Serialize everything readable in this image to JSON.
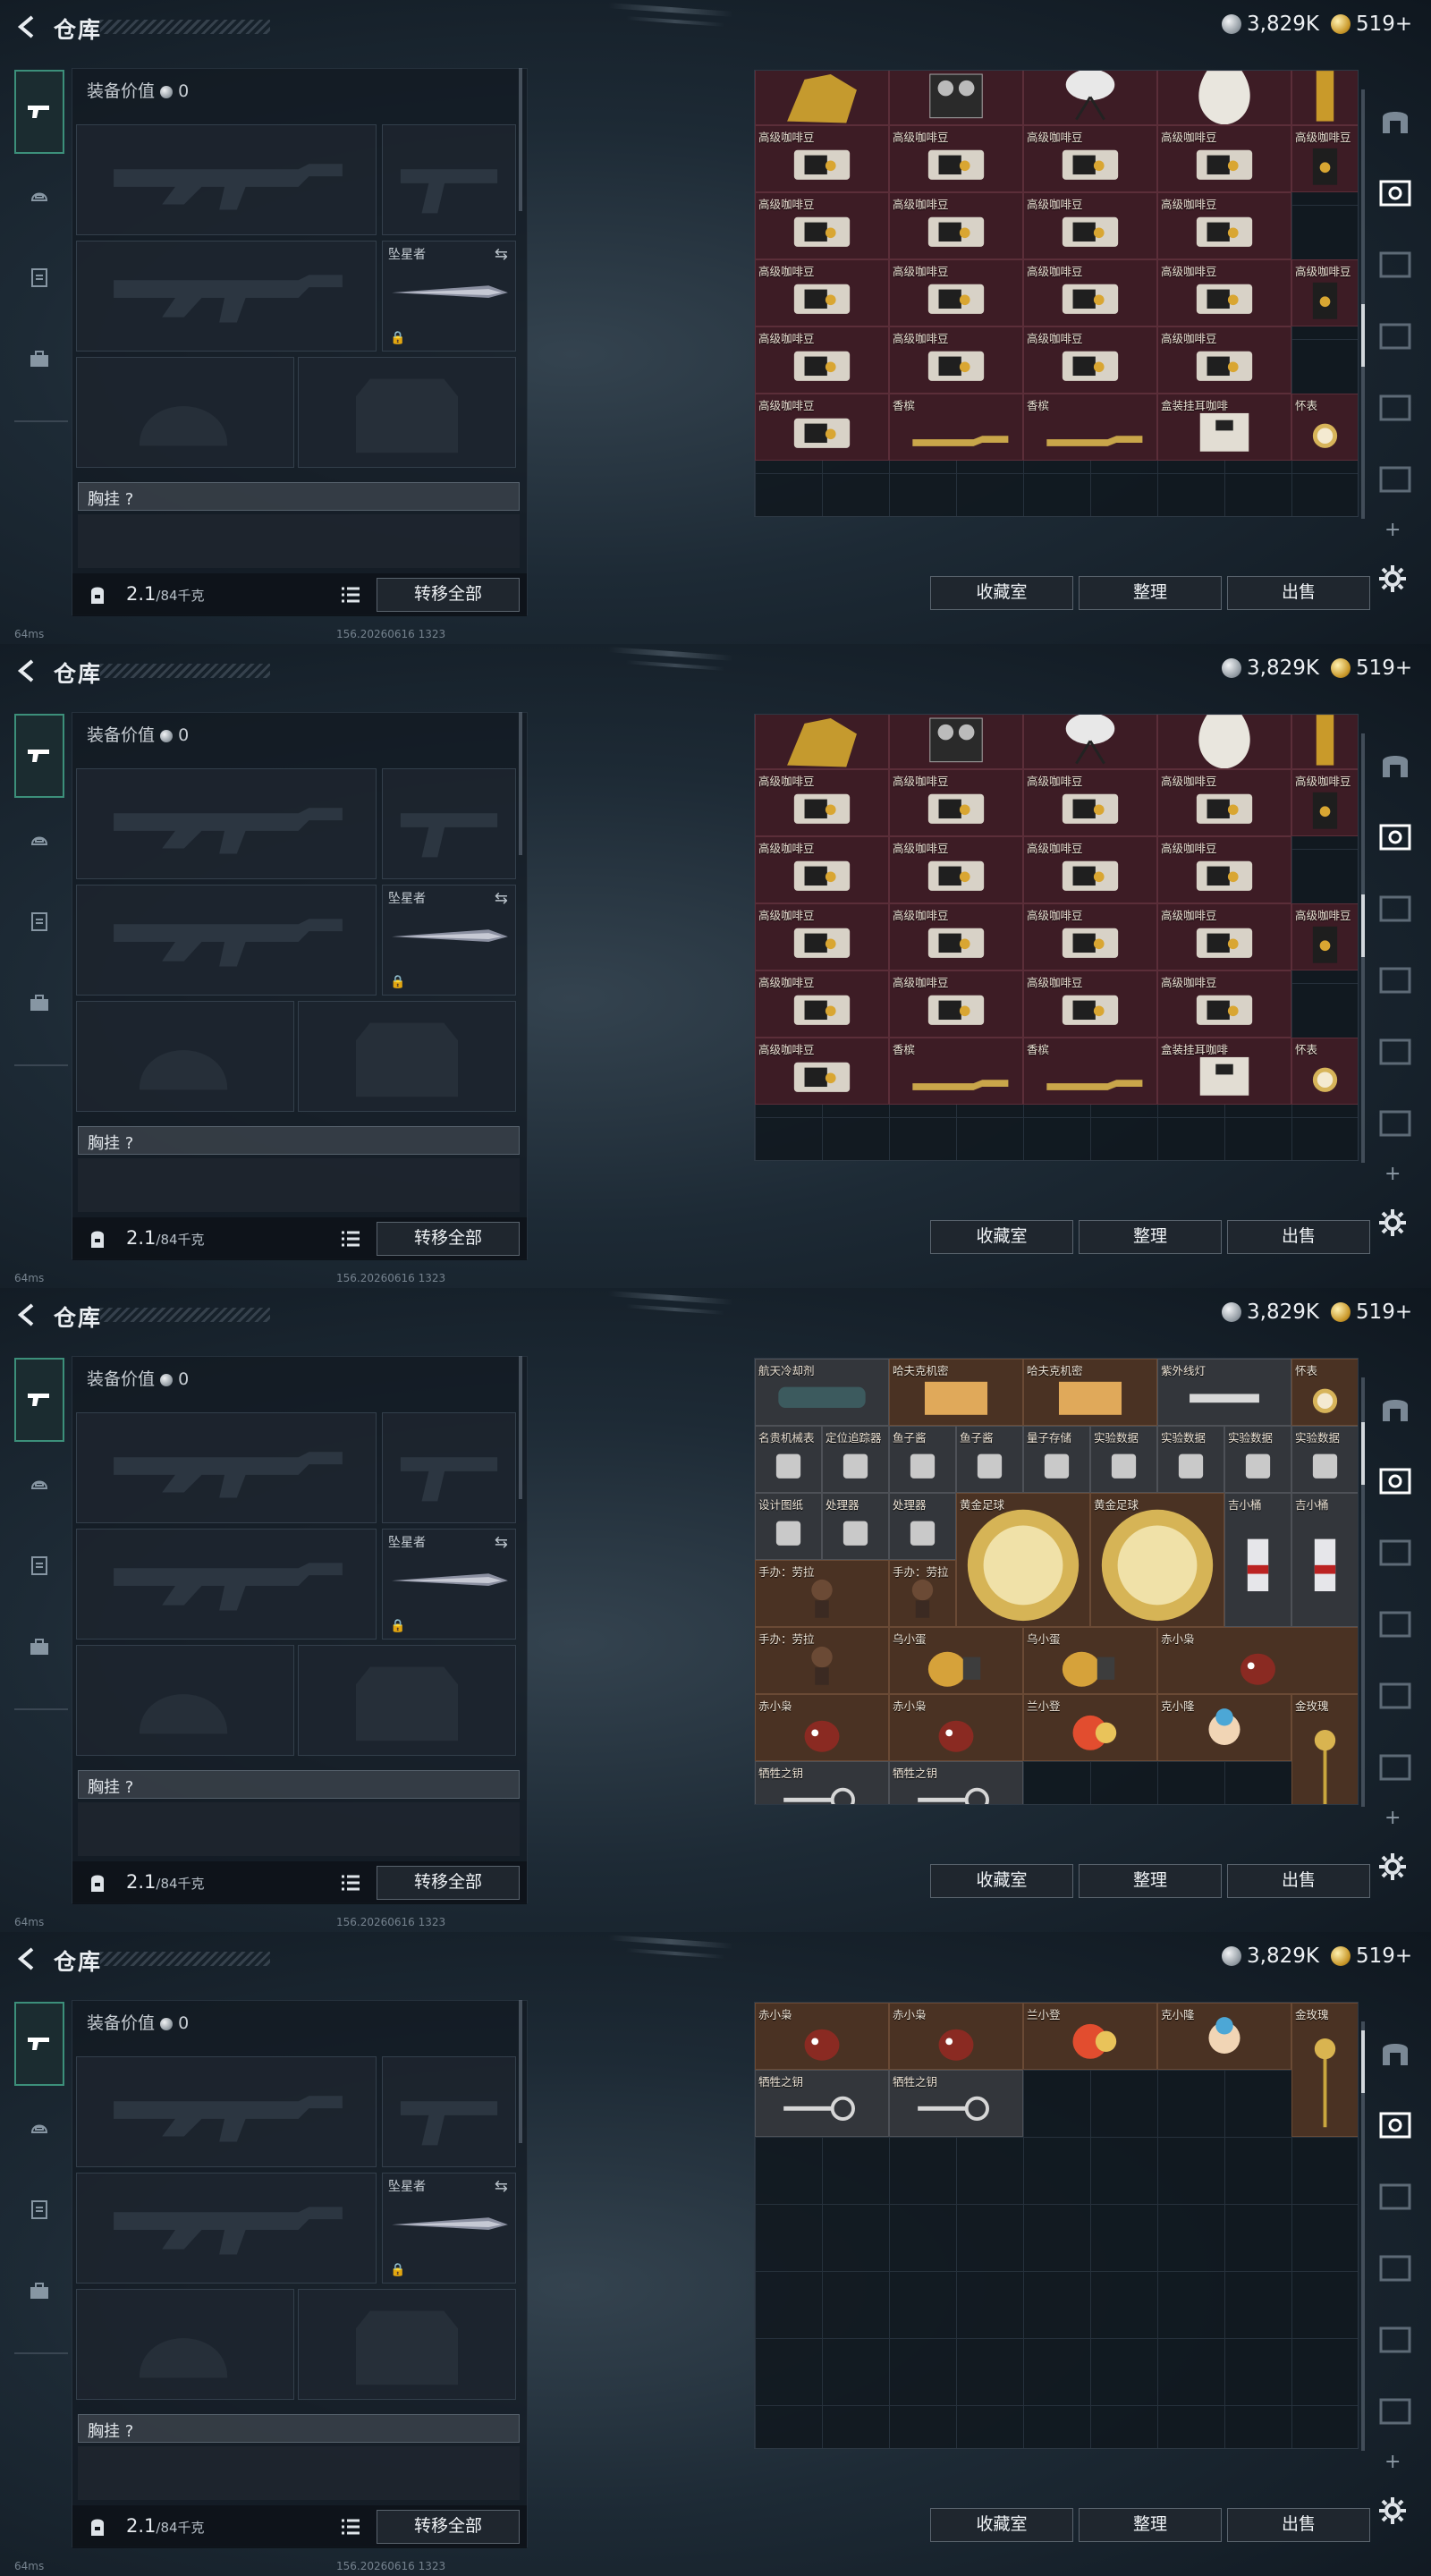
{
  "header": {
    "title": "仓库",
    "silver": "3,829K",
    "gold": "519+"
  },
  "nav": [
    "gun-icon",
    "helmet-icon",
    "clipboard-icon",
    "briefcase-icon"
  ],
  "equip": {
    "value_label": "装备价值",
    "value": "0",
    "melee_label": "坠星者",
    "rig_label": "胸挂",
    "rig_hint": "?",
    "weight": "2.1",
    "weight_max": "/84千克",
    "transfer_all": "转移全部"
  },
  "status": {
    "ping": "64ms",
    "build": "156.20260616 1323"
  },
  "buttons": {
    "collection": "收藏室",
    "sort": "整理",
    "sell": "出售"
  },
  "colors": {
    "item_red": "#3d1c25",
    "item_brown": "#4a3223",
    "accent": "#3c8f7a"
  },
  "screens": [
    {
      "id": "s1",
      "items": [
        {
          "name": "",
          "icon": "gold-bust"
        },
        {
          "name": "",
          "icon": "recorder"
        },
        {
          "name": "",
          "icon": "dish"
        },
        {
          "name": "",
          "icon": "vase"
        },
        {
          "name": "",
          "icon": "gold-bar"
        },
        {
          "name": "高级咖啡豆"
        },
        {
          "name": "高级咖啡豆"
        },
        {
          "name": "高级咖啡豆"
        },
        {
          "name": "高级咖啡豆"
        },
        {
          "name": "高级咖啡豆"
        },
        {
          "name": "高级咖啡豆"
        },
        {
          "name": "高级咖啡豆"
        },
        {
          "name": "高级咖啡豆"
        },
        {
          "name": "高级咖啡豆"
        },
        {
          "name": "高级咖啡豆"
        },
        {
          "name": "高级咖啡豆"
        },
        {
          "name": "高级咖啡豆"
        },
        {
          "name": "高级咖啡豆"
        },
        {
          "name": "高级咖啡豆"
        },
        {
          "name": "高级咖啡豆"
        },
        {
          "name": "高级咖啡豆"
        },
        {
          "name": "高级咖啡豆"
        },
        {
          "name": "高级咖啡豆"
        },
        {
          "name": "高级咖啡豆"
        },
        {
          "name": "香槟"
        },
        {
          "name": "香槟"
        },
        {
          "name": "盒装挂耳咖啡"
        },
        {
          "name": "怀表"
        }
      ]
    },
    {
      "id": "s2",
      "items": [
        {
          "name": "",
          "icon": "gold-bust"
        },
        {
          "name": "",
          "icon": "recorder"
        },
        {
          "name": "",
          "icon": "dish"
        },
        {
          "name": "",
          "icon": "vase"
        },
        {
          "name": "",
          "icon": "gold-bar"
        },
        {
          "name": "高级咖啡豆"
        },
        {
          "name": "高级咖啡豆"
        },
        {
          "name": "高级咖啡豆"
        },
        {
          "name": "高级咖啡豆"
        },
        {
          "name": "高级咖啡豆"
        },
        {
          "name": "高级咖啡豆"
        },
        {
          "name": "高级咖啡豆"
        },
        {
          "name": "高级咖啡豆"
        },
        {
          "name": "高级咖啡豆"
        },
        {
          "name": "高级咖啡豆"
        },
        {
          "name": "高级咖啡豆"
        },
        {
          "name": "高级咖啡豆"
        },
        {
          "name": "高级咖啡豆"
        },
        {
          "name": "高级咖啡豆"
        },
        {
          "name": "高级咖啡豆"
        },
        {
          "name": "高级咖啡豆"
        },
        {
          "name": "高级咖啡豆"
        },
        {
          "name": "高级咖啡豆"
        },
        {
          "name": "高级咖啡豆"
        },
        {
          "name": "香槟"
        },
        {
          "name": "香槟"
        },
        {
          "name": "盒装挂耳咖啡"
        },
        {
          "name": "怀表"
        }
      ]
    },
    {
      "id": "s3",
      "items": [
        {
          "name": "航天冷却剂"
        },
        {
          "name": "哈夫克机密"
        },
        {
          "name": "哈夫克机密"
        },
        {
          "name": "紫外线灯"
        },
        {
          "name": "怀表"
        },
        {
          "name": "名贵机械表"
        },
        {
          "name": "定位追踪器"
        },
        {
          "name": "鱼子酱"
        },
        {
          "name": "鱼子酱"
        },
        {
          "name": "量子存储"
        },
        {
          "name": "实验数据"
        },
        {
          "name": "实验数据"
        },
        {
          "name": "实验数据"
        },
        {
          "name": "实验数据"
        },
        {
          "name": "设计图纸"
        },
        {
          "name": "处理器"
        },
        {
          "name": "处理器"
        },
        {
          "name": "黄金足球"
        },
        {
          "name": "黄金足球"
        },
        {
          "name": "吉小桶"
        },
        {
          "name": "吉小桶"
        },
        {
          "name": "手办：劳拉"
        },
        {
          "name": "手办：劳拉"
        },
        {
          "name": "手办：劳拉"
        },
        {
          "name": "乌小蛋"
        },
        {
          "name": "乌小蛋"
        },
        {
          "name": "赤小枭"
        },
        {
          "name": "赤小枭"
        },
        {
          "name": "赤小枭"
        },
        {
          "name": "兰小登"
        },
        {
          "name": "克小隆"
        },
        {
          "name": "金玫瑰"
        },
        {
          "name": "牺牲之钥"
        },
        {
          "name": "牺牲之钥"
        }
      ]
    },
    {
      "id": "s4",
      "items": [
        {
          "name": "赤小枭"
        },
        {
          "name": "赤小枭"
        },
        {
          "name": "兰小登"
        },
        {
          "name": "克小隆"
        },
        {
          "name": "金玫瑰"
        },
        {
          "name": "牺牲之钥"
        },
        {
          "name": "牺牲之钥"
        }
      ]
    }
  ]
}
